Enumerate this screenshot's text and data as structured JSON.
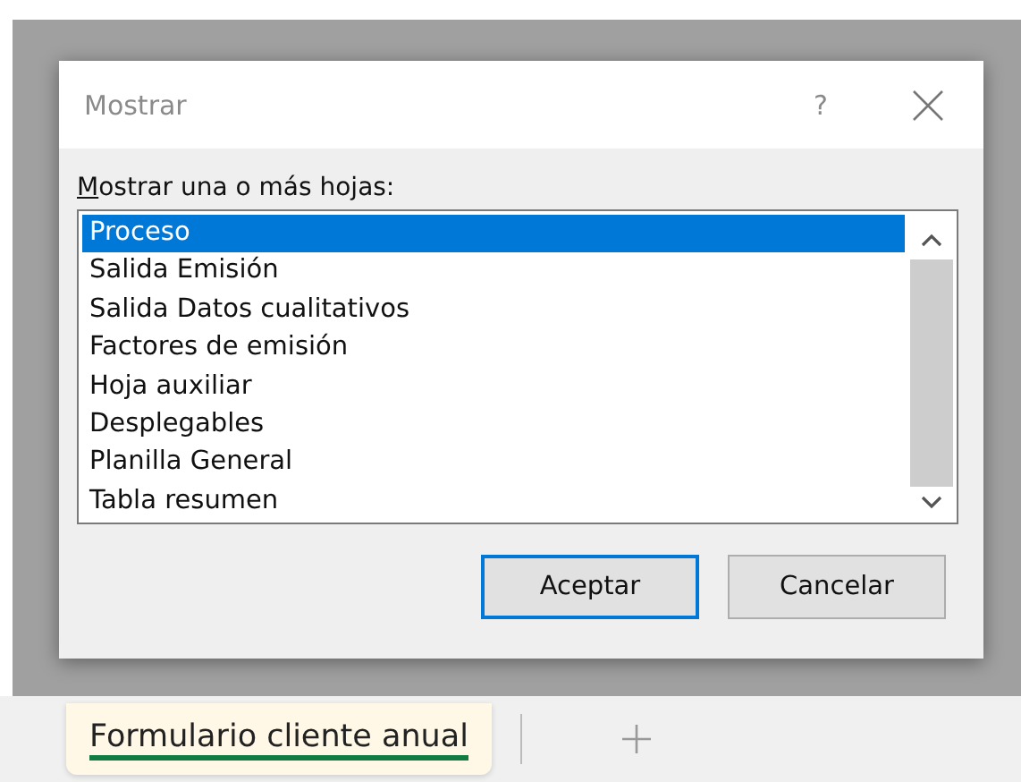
{
  "dialog": {
    "title": "Mostrar",
    "help": "?",
    "label": "Mostrar una o más hojas:",
    "label_mnemonic_underlined": true,
    "sheets": [
      {
        "label": "Proceso",
        "selected": true
      },
      {
        "label": "Salida Emisión",
        "selected": false
      },
      {
        "label": "Salida Datos cualitativos",
        "selected": false
      },
      {
        "label": "Factores de emisión",
        "selected": false
      },
      {
        "label": "Hoja auxiliar",
        "selected": false
      },
      {
        "label": "Desplegables",
        "selected": false
      },
      {
        "label": "Planilla General",
        "selected": false
      },
      {
        "label": "Tabla resumen",
        "selected": false
      }
    ],
    "buttons": [
      {
        "label": "Aceptar",
        "selected": true
      },
      {
        "label": "Cancelar",
        "selected": false
      }
    ]
  },
  "sheet_tabs": [
    {
      "label": "Formulario cliente anual",
      "selected": true
    }
  ]
}
